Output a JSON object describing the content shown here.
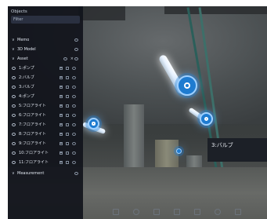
{
  "panel": {
    "title": "Objects",
    "filter_placeholder": "Filter",
    "groups": [
      {
        "label": "Memo"
      },
      {
        "label": "3D Model"
      },
      {
        "label": "Asset"
      }
    ],
    "asset_items": [
      "1:ポンプ",
      "2:バルブ",
      "3:バルブ",
      "4:ポンプ",
      "5:フロアライト",
      "6:フロアライト",
      "7:フロアライト",
      "8:フロアライト",
      "9:フロアライト",
      "10:フロアライト",
      "11:フロアライト"
    ],
    "measurement_label": "Measurement"
  },
  "viewer": {
    "tag_label": "3:バルブ",
    "toolbar_icons": [
      "measure-icon",
      "pin-icon",
      "layers-icon",
      "map-icon",
      "share-icon",
      "settings-icon",
      "fullscreen-icon"
    ]
  },
  "colors": {
    "panel_bg": "#11141b",
    "hotspot": "#1e7bd0",
    "pipe": "#2b5f5a"
  }
}
